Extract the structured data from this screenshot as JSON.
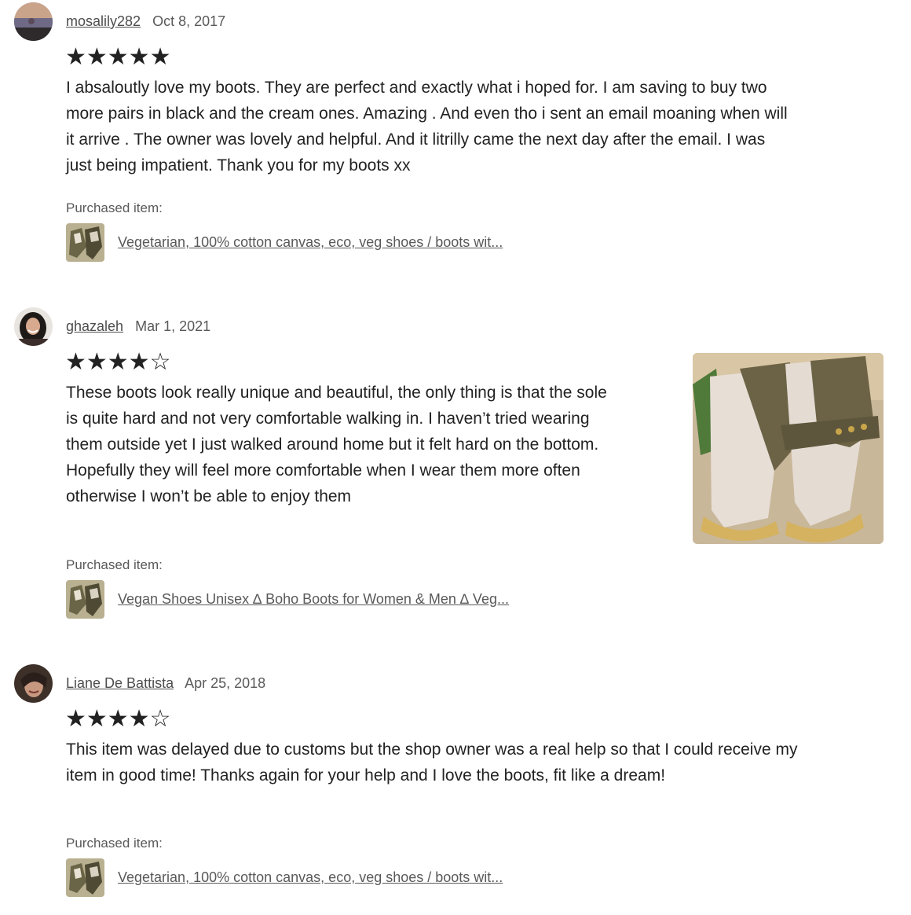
{
  "reviews": [
    {
      "user": "mosalily282",
      "date": "Oct 8, 2017",
      "stars": "★★★★★",
      "text": "I absaloutly love my boots. They are perfect and exactly what i hoped for. I am saving to buy two more pairs in black and the cream ones. Amazing . And even tho i sent an email moaning when will it arrive . The owner was lovely and helpful. And it litrilly came the next day after the email. I was just being impatient. Thank you for my boots xx",
      "rating": 5,
      "purchased_label": "Purchased item:",
      "item": "Vegetarian, 100% cotton canvas, eco, veg shoes / boots wit..."
    },
    {
      "user": "ghazaleh",
      "date": "Mar 1, 2021",
      "stars": "★★★★☆",
      "text": "These boots look really unique and beautiful, the only thing is that the sole is quite hard and not very comfortable walking in. I haven’t tried wearing them outside yet I just walked around home but it felt hard on the bottom. Hopefully they will feel more comfortable when I wear them more often otherwise I won’t be able to enjoy them",
      "rating": 4,
      "purchased_label": "Purchased item:",
      "item": "Vegan Shoes Unisex ∆ Boho Boots for Women & Men ∆ Veg..."
    },
    {
      "user": "Liane De Battista",
      "date": "Apr 25, 2018",
      "stars": "★★★★☆",
      "text": "This item was delayed due to customs but the shop owner was a real help so that I could receive my item in good time! Thanks again for your help and I love the boots, fit like a dream!",
      "rating": 4,
      "purchased_label": "Purchased item:",
      "item": "Vegetarian, 100% cotton canvas, eco, veg shoes / boots wit..."
    }
  ],
  "colors": {
    "text": "#222222",
    "muted": "#595959",
    "star": "#222222"
  }
}
